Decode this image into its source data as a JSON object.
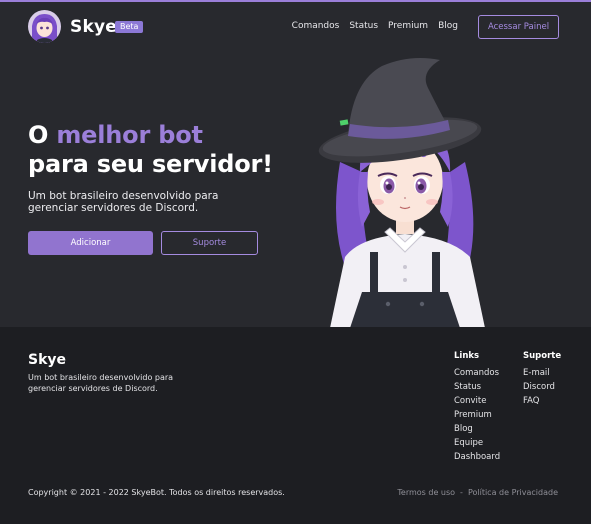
{
  "nav": {
    "brand": "Skye",
    "badge": "Beta",
    "links": [
      "Comandos",
      "Status",
      "Premium",
      "Blog"
    ],
    "panel_button": "Acessar Painel"
  },
  "hero": {
    "title_prefix": "O ",
    "title_accent": "melhor bot",
    "title_line2": "para seu servidor!",
    "subtitle": "Um bot brasileiro desenvolvido para gerenciar servidores de Discord.",
    "add_button": "Adicionar",
    "support_button": "Suporte"
  },
  "footer": {
    "brand": "Skye",
    "description": "Um bot brasileiro desenvolvido para gerenciar servidores de Discord.",
    "links_heading": "Links",
    "links": [
      "Comandos",
      "Status",
      "Convite",
      "Premium",
      "Blog",
      "Equipe",
      "Dashboard"
    ],
    "support_heading": "Suporte",
    "support_links": [
      "E-mail",
      "Discord",
      "FAQ"
    ],
    "copyright": "Copyright © 2021 - 2022 SkyeBot. Todos os direitos reservados.",
    "terms": "Termos de uso",
    "separator": "-",
    "privacy": "Política de Privacidade"
  },
  "colors": {
    "accent": "#9b7fd9",
    "background": "#28292e",
    "footer_background": "#1d1e22"
  }
}
